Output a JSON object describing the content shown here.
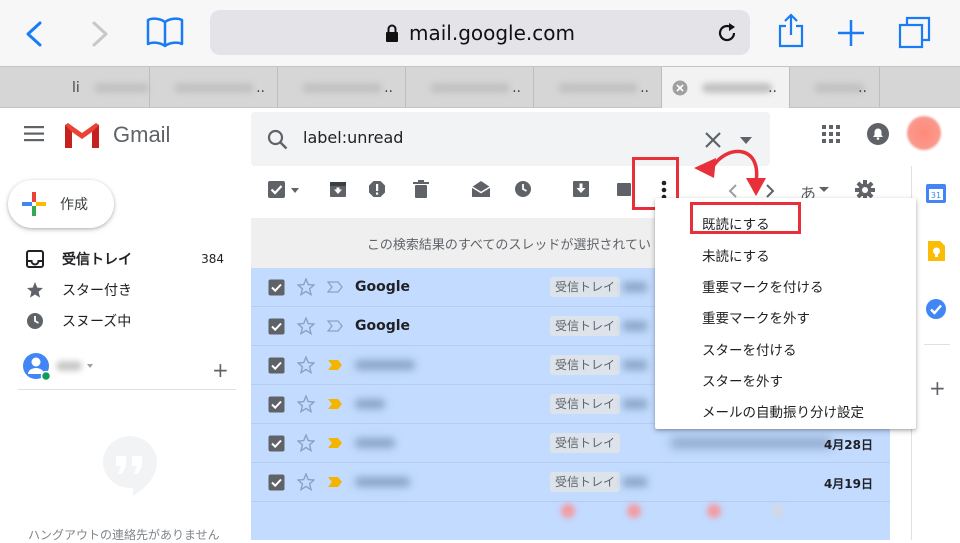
{
  "browser": {
    "url": "mail.google.com",
    "tabs": [
      {
        "label": "li"
      },
      {
        "label": ""
      },
      {
        "label": ""
      },
      {
        "label": ""
      },
      {
        "label": ""
      },
      {
        "label": ""
      }
    ],
    "tab_ellipsis": ".."
  },
  "gmail": {
    "logo_text": "Gmail",
    "search": {
      "value": "label:unread"
    },
    "compose_label": "作成",
    "nav": [
      {
        "label": "受信トレイ",
        "count": "384"
      },
      {
        "label": "スター付き",
        "count": ""
      },
      {
        "label": "スヌーズ中",
        "count": ""
      }
    ],
    "hangouts_add": "+",
    "hangouts_empty": "ハングアウトの連絡先がありません",
    "toolbar_lang": "あ",
    "select_banner": "この検索結果のすべてのスレッドが選択されてい",
    "mails": [
      {
        "sender": "Google",
        "label": "受信トレイ",
        "date": ""
      },
      {
        "sender": "Google",
        "label": "受信トレイ",
        "date": ""
      },
      {
        "sender": "",
        "label": "受信トレイ",
        "date": ""
      },
      {
        "sender": "",
        "label": "受信トレイ",
        "date": ""
      },
      {
        "sender": "",
        "label": "受信トレイ",
        "date": "4月28日"
      },
      {
        "sender": "",
        "label": "受信トレイ",
        "date": "4月19日"
      }
    ],
    "more_menu": [
      "既読にする",
      "未読にする",
      "重要マークを付ける",
      "重要マークを外す",
      "スターを付ける",
      "スターを外す",
      "メールの自動振り分け設定"
    ],
    "calendar_day": "31",
    "side_add": "+"
  },
  "colors": {
    "highlight": "#e8303a",
    "selected_row": "#c2dbff",
    "accent_blue": "#1a73e8"
  }
}
